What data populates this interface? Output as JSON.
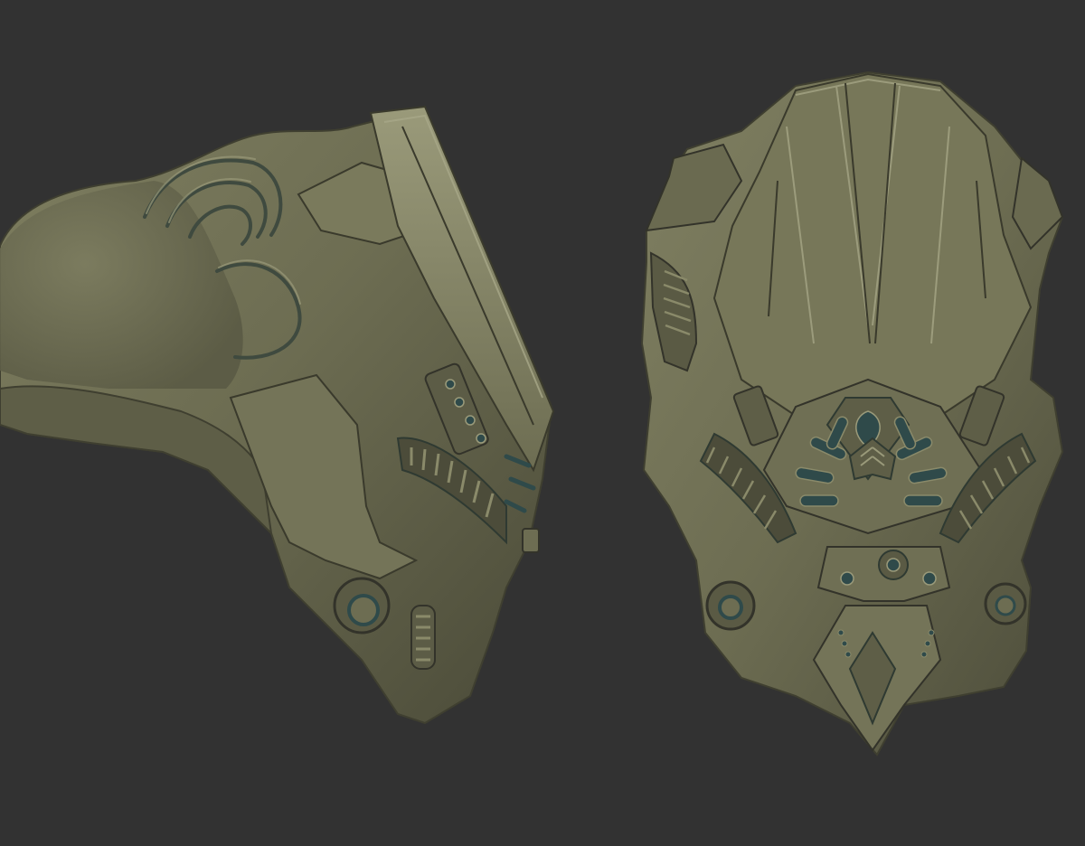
{
  "scene": {
    "background_color": "#323232",
    "clay_color": "#6d6d52",
    "clay_highlight": "#9a9a7a",
    "clay_shadow": "#3f3f30",
    "cavity_color": "#2f4a4a",
    "models": [
      {
        "view": "side"
      },
      {
        "view": "front"
      }
    ]
  }
}
